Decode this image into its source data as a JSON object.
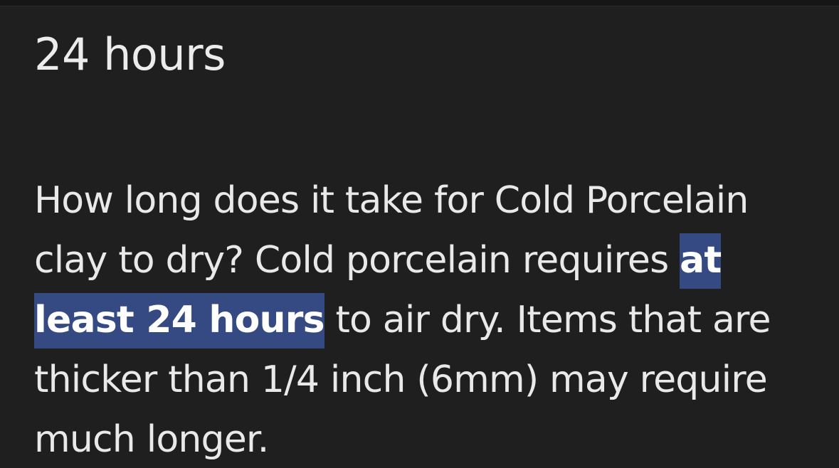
{
  "answer": {
    "title": "24 hours"
  },
  "snippet": {
    "before_highlight": "How long does it take for Cold Porcelain clay to dry? Cold porcelain requires ",
    "highlight": "at least 24 hours",
    "after_highlight": " to air dry. Items that are thicker than 1/4 inch (6mm) may require much longer."
  },
  "colors": {
    "background": "#1f1f1f",
    "text": "#e9e9e9",
    "highlight_background": "#354a82",
    "highlight_text": "#ffffff"
  }
}
